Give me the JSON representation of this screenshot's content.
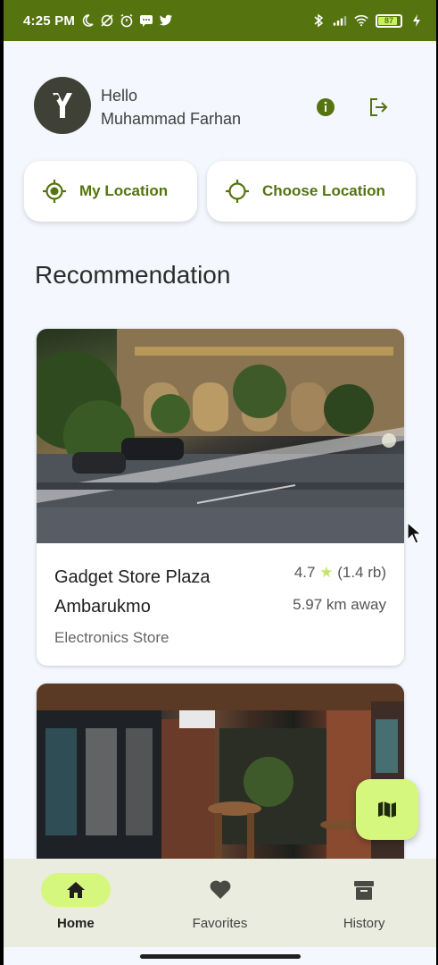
{
  "status_bar": {
    "time": "4:25 PM",
    "battery": "87",
    "colors": {
      "background": "#55730f",
      "battery_fill": "#c8f25b"
    },
    "icons_left": [
      "moon-icon",
      "alarm-off-icon",
      "alarm-icon",
      "message-icon",
      "twitter-icon"
    ],
    "icons_right": [
      "bluetooth-icon",
      "signal-icon",
      "wifi-icon",
      "battery-icon",
      "charging-icon"
    ]
  },
  "header": {
    "greeting": "Hello",
    "user_name": "Muhammad Farhan",
    "icons": [
      "info-icon",
      "logout-icon"
    ]
  },
  "location_buttons": {
    "my_location": "My Location",
    "choose_location": "Choose Location"
  },
  "section": {
    "title": "Recommendation"
  },
  "places": [
    {
      "name": "Gadget Store Plaza Ambarukmo",
      "rating": "4.7",
      "reviews": "(1.4 rb)",
      "distance": "5.97 km away",
      "category": "Electronics Store"
    }
  ],
  "fab": {
    "icon": "map-icon"
  },
  "bottom_nav": {
    "items": [
      {
        "label": "Home",
        "icon": "home-icon",
        "active": true
      },
      {
        "label": "Favorites",
        "icon": "heart-icon",
        "active": false
      },
      {
        "label": "History",
        "icon": "archive-icon",
        "active": false
      }
    ]
  },
  "theme": {
    "accent": "#55730f",
    "accent_light": "#d6f77e",
    "background": "#f4f7fd",
    "nav_background": "#e9ecde"
  }
}
